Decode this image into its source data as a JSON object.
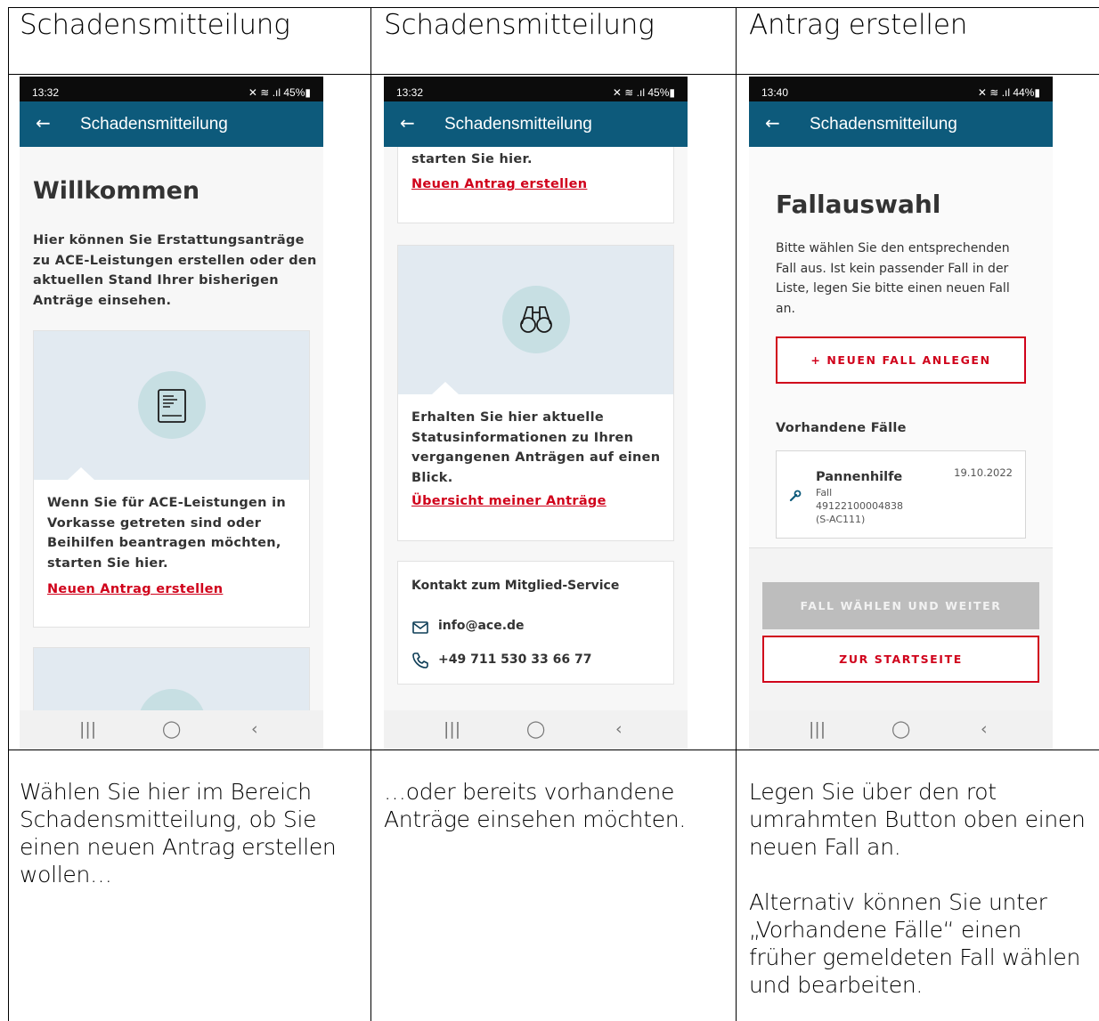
{
  "columns": [
    {
      "title": "Schadensmitteilung",
      "caption": "Wählen Sie hier im Bereich Schadensmitteilung, ob Sie einen neuen Antrag erstellen wollen…",
      "phone": {
        "time": "13:32",
        "status_icons": "✕ ≋ .ıl 45%▮",
        "appbar_title": "Schadensmitteilung",
        "heading": "Willkommen",
        "intro": "Hier können Sie Erstattungsanträge zu ACE-Leistungen erstellen oder den aktuellen Stand Ihrer bisherigen Anträge einsehen.",
        "card_text": "Wenn Sie für ACE-Leistungen in Vorkasse getreten sind oder Beihilfen beantragen möchten, starten Sie hier.",
        "card_link": "Neuen Antrag erstellen",
        "icon": "document-icon"
      }
    },
    {
      "title": "Schadensmitteilung",
      "caption": "…oder bereits vorhandene Anträge einsehen möchten.",
      "phone": {
        "time": "13:32",
        "status_icons": "✕ ≋ .ıl 45%▮",
        "appbar_title": "Schadensmitteilung",
        "top_text": "starten Sie hier.",
        "top_link": "Neuen Antrag erstellen",
        "card_text": "Erhalten Sie hier aktuelle Statusinformationen zu Ihren vergangenen Anträgen auf einen Blick.",
        "card_link": "Übersicht meiner Anträge",
        "contact_title": "Kontakt zum Mitglied-Service",
        "email": "info@ace.de",
        "phone_number": "+49 711 530 33 66 77",
        "icon": "binoculars-icon"
      }
    },
    {
      "title": "Antrag erstellen",
      "caption": "Legen Sie über den rot umrahmten Button oben einen neuen Fall an.",
      "caption2": "Alternativ können Sie unter „Vorhandene Fälle“ einen früher gemeldeten Fall wählen und bearbeiten.",
      "phone": {
        "time": "13:40",
        "status_icons": "✕ ≋ .ıl 44%▮",
        "appbar_title": "Schadensmitteilung",
        "heading": "Fallauswahl",
        "intro": "Bitte wählen Sie den entsprechenden Fall aus. Ist kein passender Fall in der Liste, legen Sie bitte einen neuen Fall an.",
        "new_case_button": "+ NEUEN FALL ANLEGEN",
        "existing_title": "Vorhandene Fälle",
        "case": {
          "name": "Pannenhilfe",
          "date": "19.10.2022",
          "label": "Fall",
          "number": "49122100004838",
          "code": "(S-AC111)"
        },
        "choose_button": "FALL WÄHLEN UND WEITER",
        "home_button": "ZUR STARTSEITE"
      }
    }
  ],
  "nav": {
    "recents": "|||",
    "home": "◯",
    "back": "‹"
  },
  "ui": {
    "back_arrow": "←"
  }
}
